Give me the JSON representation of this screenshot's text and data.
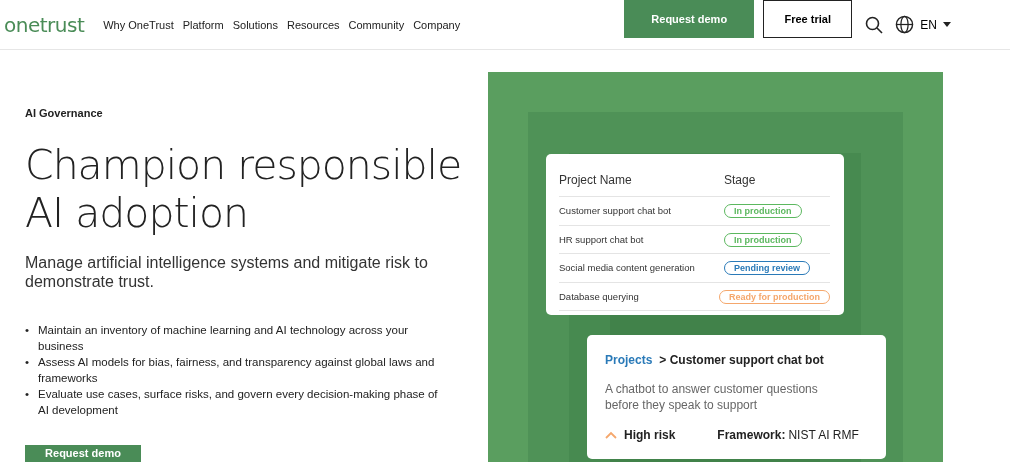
{
  "header": {
    "logo": "onetrust",
    "nav": [
      "Why OneTrust",
      "Platform",
      "Solutions",
      "Resources",
      "Community",
      "Company"
    ],
    "request_demo": "Request demo",
    "free_trial": "Free trial",
    "language": "EN"
  },
  "hero": {
    "eyebrow": "AI Governance",
    "headline": "Champion responsible AI adoption",
    "subtitle": "Manage artificial intelligence systems and mitigate risk to demonstrate trust.",
    "bullets": [
      {
        "marker": "•",
        "text": "Maintain an inventory of machine learning and AI technology across your business"
      },
      {
        "marker": "•",
        "text": "Assess AI models for bias, fairness, and transparency against global laws and frameworks"
      },
      {
        "marker": "•",
        "text": "Evaluate use cases, surface risks, and govern every decision-making phase of AI development"
      }
    ],
    "cta": "Request demo"
  },
  "projects_table": {
    "columns": [
      "Project Name",
      "Stage"
    ],
    "rows": [
      {
        "name": "Customer support chat bot",
        "stage": "In production",
        "color": "#5cb85f"
      },
      {
        "name": "HR support chat bot",
        "stage": "In production",
        "color": "#5cb85f"
      },
      {
        "name": "Social media content generation",
        "stage": "Pending review",
        "color": "#2a7ab8"
      },
      {
        "name": "Database querying",
        "stage": "Ready for production",
        "color": "#f5a76c"
      }
    ]
  },
  "detail_card": {
    "breadcrumb_link": "Projects",
    "breadcrumb_current": "> Customer support chat bot",
    "description": "A chatbot to answer customer questions before they speak to support",
    "risk": "High risk",
    "framework_label": "Framework:",
    "framework_value": "NIST AI RMF"
  }
}
